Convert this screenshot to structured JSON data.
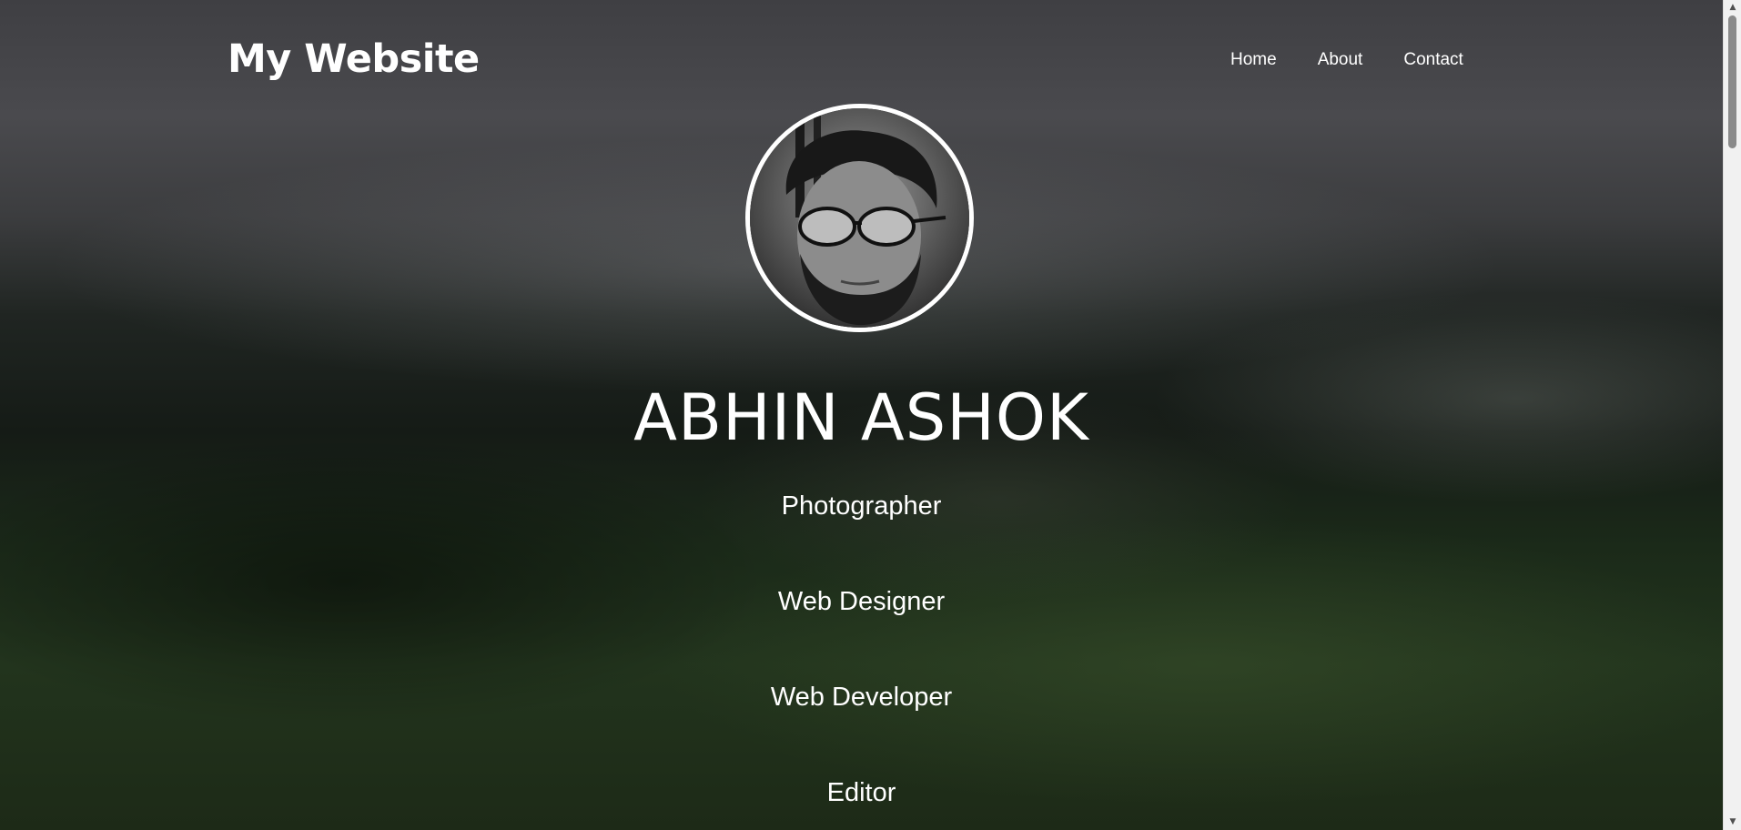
{
  "header": {
    "site_title": "My Website",
    "nav": [
      {
        "label": "Home"
      },
      {
        "label": "About"
      },
      {
        "label": "Contact"
      }
    ]
  },
  "hero": {
    "name": "ABHIN ASHOK",
    "roles": [
      "Photographer",
      "Web Designer",
      "Web Developer",
      "Editor"
    ]
  },
  "colors": {
    "text": "#ffffff",
    "avatar_border": "#ffffff",
    "scrollbar_track": "#f1f1f1",
    "scrollbar_thumb": "#8a8a8a"
  },
  "icons": {
    "scroll_up": "triangle-up-icon",
    "scroll_down": "triangle-down-icon"
  }
}
